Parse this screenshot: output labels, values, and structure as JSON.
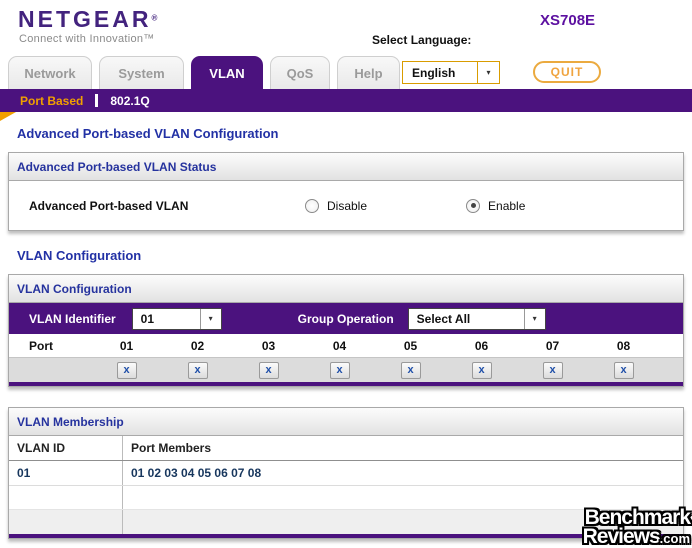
{
  "colors": {
    "brand_purple": "#4B127E",
    "logo_purple": "#43237E",
    "model_purple": "#5C10A0",
    "heading_navy": "#2231A5",
    "accent_orange": "#F0A000",
    "quit_orange": "#F0A43F"
  },
  "brand": {
    "logo_text": "NETGEAR",
    "logo_reg": "®",
    "tagline": "Connect with Innovation™",
    "model": "XS708E"
  },
  "header": {
    "select_language_label": "Select Language:",
    "language_value": "English",
    "dropdown_arrow": "▾",
    "quit_label": "QUIT"
  },
  "tabs": [
    {
      "label": "Network",
      "active": false
    },
    {
      "label": "System",
      "active": false
    },
    {
      "label": "VLAN",
      "active": true
    },
    {
      "label": "QoS",
      "active": false
    },
    {
      "label": "Help",
      "active": false
    }
  ],
  "subnav": [
    {
      "label": "Port Based",
      "active": true
    },
    {
      "label": "802.1Q",
      "active": false
    }
  ],
  "page": {
    "title": "Advanced Port-based VLAN Configuration"
  },
  "status_section": {
    "header": "Advanced Port-based VLAN Status",
    "row_label": "Advanced Port-based VLAN",
    "options": [
      {
        "label": "Disable",
        "selected": false
      },
      {
        "label": "Enable",
        "selected": true
      }
    ]
  },
  "vlan_config": {
    "heading": "VLAN Configuration",
    "header": "VLAN Configuration",
    "vlan_identifier_label": "VLAN Identifier",
    "vlan_identifier_value": "01",
    "group_operation_label": "Group Operation",
    "group_operation_value": "Select All",
    "port_label": "Port",
    "ports": [
      "01",
      "02",
      "03",
      "04",
      "05",
      "06",
      "07",
      "08"
    ],
    "port_button_label": "x"
  },
  "membership": {
    "header": "VLAN Membership",
    "columns": [
      "VLAN ID",
      "Port Members"
    ],
    "rows": [
      {
        "vlan_id": "01",
        "port_members": "01 02 03 04 05 06 07 08"
      }
    ]
  },
  "watermark": {
    "line1": "Benchmark",
    "line2": "Reviews",
    "suffix": ".com"
  }
}
